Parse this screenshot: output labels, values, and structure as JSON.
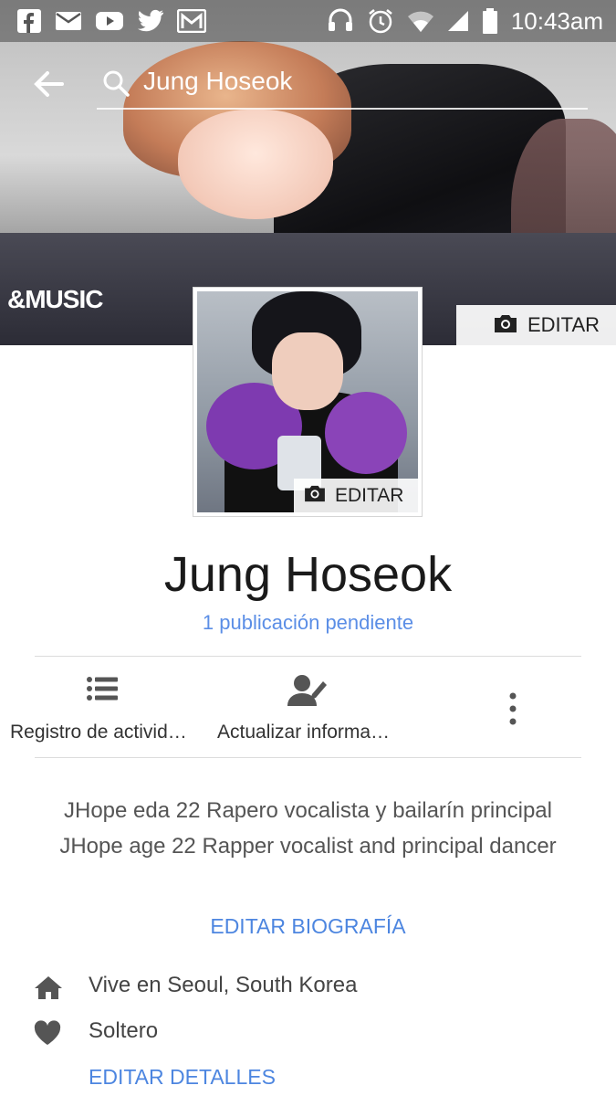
{
  "status_bar": {
    "time": "10:43am",
    "left_icons": [
      "facebook-icon",
      "mail-icon",
      "youtube-icon",
      "twitter-icon",
      "gmail-icon"
    ],
    "right_icons": [
      "headset-icon",
      "alarm-icon",
      "wifi-icon",
      "signal-icon",
      "battery-icon"
    ]
  },
  "search": {
    "query": "Jung Hoseok"
  },
  "cover": {
    "logo_text": "&MUSIC",
    "edit_label": "EDITAR"
  },
  "profile": {
    "edit_label": "EDITAR",
    "name": "Jung Hoseok",
    "pending": "1 publicación pendiente"
  },
  "actions": [
    {
      "label": "Registro de activid…",
      "icon": "list-icon"
    },
    {
      "label": "Actualizar informa…",
      "icon": "edit-profile-icon"
    },
    {
      "icon": "more-icon"
    }
  ],
  "bio": {
    "text": "JHope eda 22  Rapero vocalista y bailarín principal JHope age 22 Rapper vocalist and principal dancer",
    "edit_link": "EDITAR BIOGRAFÍA"
  },
  "details": [
    {
      "icon": "home-icon",
      "text": "Vive en Seoul, South Korea"
    },
    {
      "icon": "heart-icon",
      "text": "Soltero"
    }
  ],
  "edit_details_link": "EDITAR DETALLES",
  "colors": {
    "link": "#4d86e0",
    "pending": "#5b8ee6",
    "text": "#444444"
  }
}
